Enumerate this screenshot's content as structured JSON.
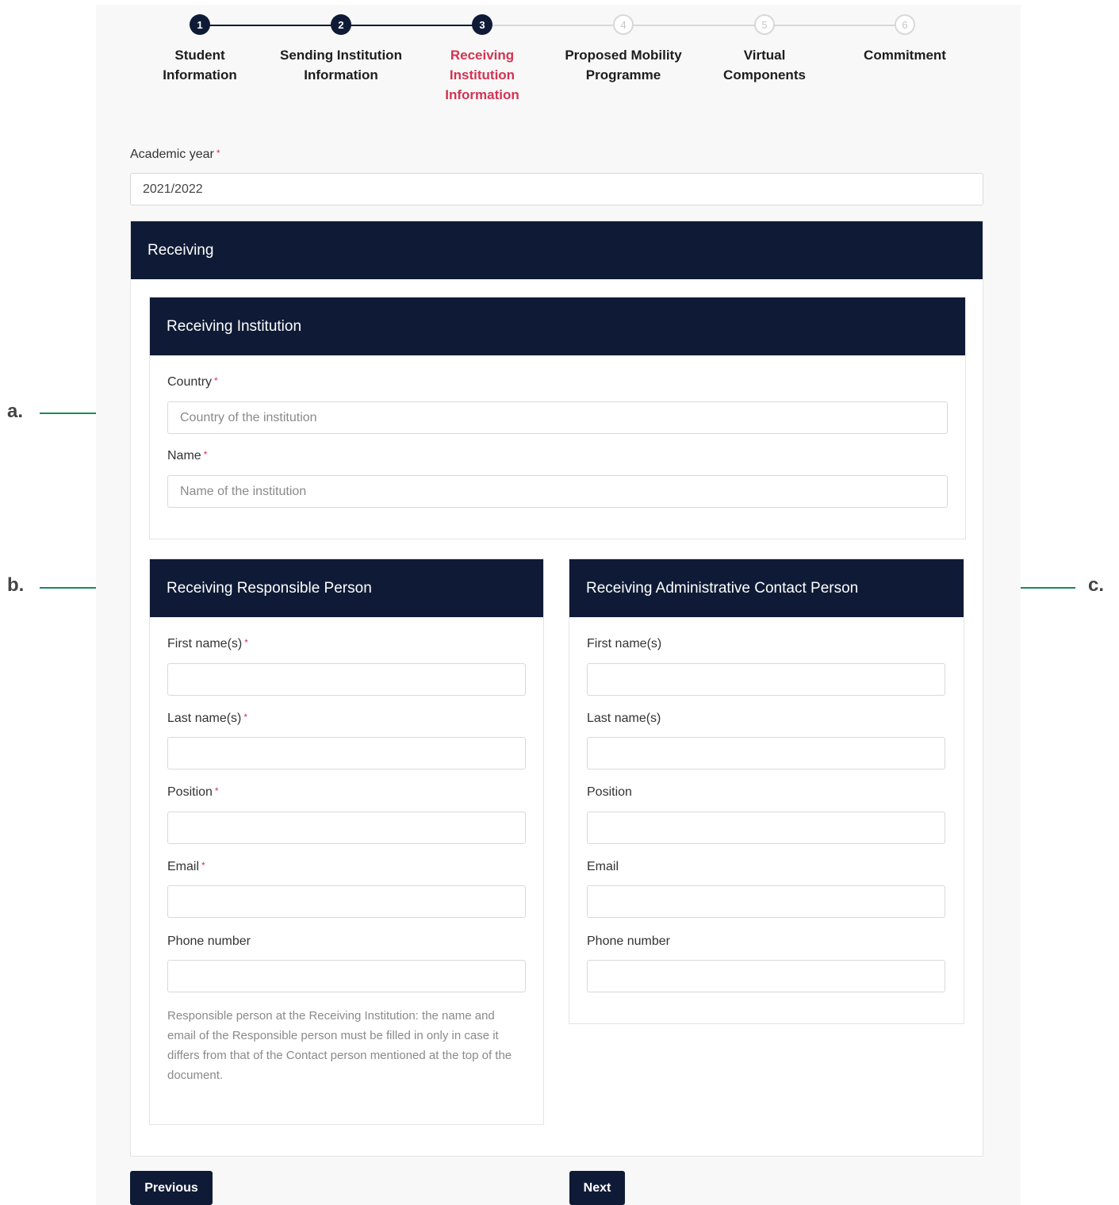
{
  "stepper": {
    "steps": [
      {
        "number": "1",
        "line1": "Student",
        "line2": "Information",
        "line3": "",
        "state": "done"
      },
      {
        "number": "2",
        "line1": "Sending Institution",
        "line2": "Information",
        "line3": "",
        "state": "done"
      },
      {
        "number": "3",
        "line1": "Receiving",
        "line2": "Institution",
        "line3": "Information",
        "state": "active"
      },
      {
        "number": "4",
        "line1": "Proposed Mobility",
        "line2": "Programme",
        "line3": "",
        "state": "todo"
      },
      {
        "number": "5",
        "line1": "Virtual",
        "line2": "Components",
        "line3": "",
        "state": "todo"
      },
      {
        "number": "6",
        "line1": "Commitment",
        "line2": "",
        "line3": "",
        "state": "todo"
      }
    ]
  },
  "academic_year": {
    "label": "Academic year",
    "required_mark": "*",
    "value": "2021/2022"
  },
  "receiving": {
    "title": "Receiving",
    "institution": {
      "title": "Receiving Institution",
      "country": {
        "label": "Country",
        "required_mark": "*",
        "placeholder": "Country of the institution"
      },
      "name": {
        "label": "Name",
        "required_mark": "*",
        "placeholder": "Name of the institution"
      }
    },
    "responsible": {
      "title": "Receiving Responsible Person",
      "first_name": {
        "label": "First name(s)",
        "required_mark": "*"
      },
      "last_name": {
        "label": "Last name(s)",
        "required_mark": "*"
      },
      "position": {
        "label": "Position",
        "required_mark": "*"
      },
      "email": {
        "label": "Email",
        "required_mark": "*"
      },
      "phone": {
        "label": "Phone number"
      },
      "help": "Responsible person at the Receiving Institution: the name and email of the Responsible person must be filled in only in case it differs from that of the Contact person mentioned at the top of the document."
    },
    "admin": {
      "title": "Receiving Administrative Contact Person",
      "first_name": {
        "label": "First name(s)"
      },
      "last_name": {
        "label": "Last name(s)"
      },
      "position": {
        "label": "Position"
      },
      "email": {
        "label": "Email"
      },
      "phone": {
        "label": "Phone number"
      }
    }
  },
  "buttons": {
    "previous": "Previous",
    "next": "Next"
  },
  "annotations": {
    "a": "a.",
    "b": "b.",
    "c": "c."
  },
  "colors": {
    "navy": "#0f1b36",
    "active_step": "#d23452",
    "arrow": "#1b8a5a"
  }
}
